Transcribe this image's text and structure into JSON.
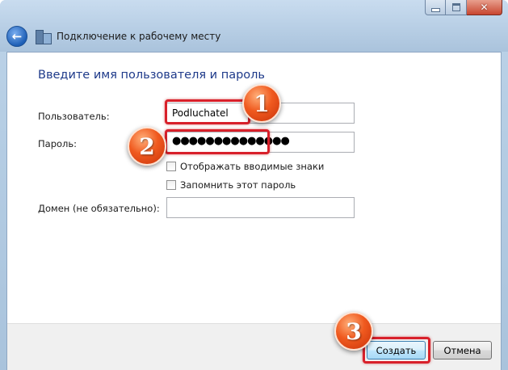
{
  "window": {
    "title": "Подключение к рабочему месту",
    "controls": {
      "minimize": "",
      "maximize": "",
      "close": "✕"
    }
  },
  "nav": {
    "back_icon": "back-arrow-icon",
    "app_icon": "network-workplace-icon"
  },
  "form": {
    "heading": "Введите имя пользователя и пароль",
    "username_label": "Пользователь:",
    "username_value": "Podluchatel",
    "password_label": "Пароль:",
    "password_value": "●●●●●●●●●●●●●●",
    "show_chars_label": "Отображать вводимые знаки",
    "show_chars_checked": false,
    "remember_label": "Запомнить этот пароль",
    "remember_checked": false,
    "domain_label": "Домен (не обязательно):",
    "domain_value": ""
  },
  "footer": {
    "create_label": "Создать",
    "cancel_label": "Отмена"
  },
  "annotations": {
    "badge_1": "1",
    "badge_2": "2",
    "badge_3": "3",
    "highlight_color": "#d8202a",
    "badge_color": "#f05a1f"
  }
}
